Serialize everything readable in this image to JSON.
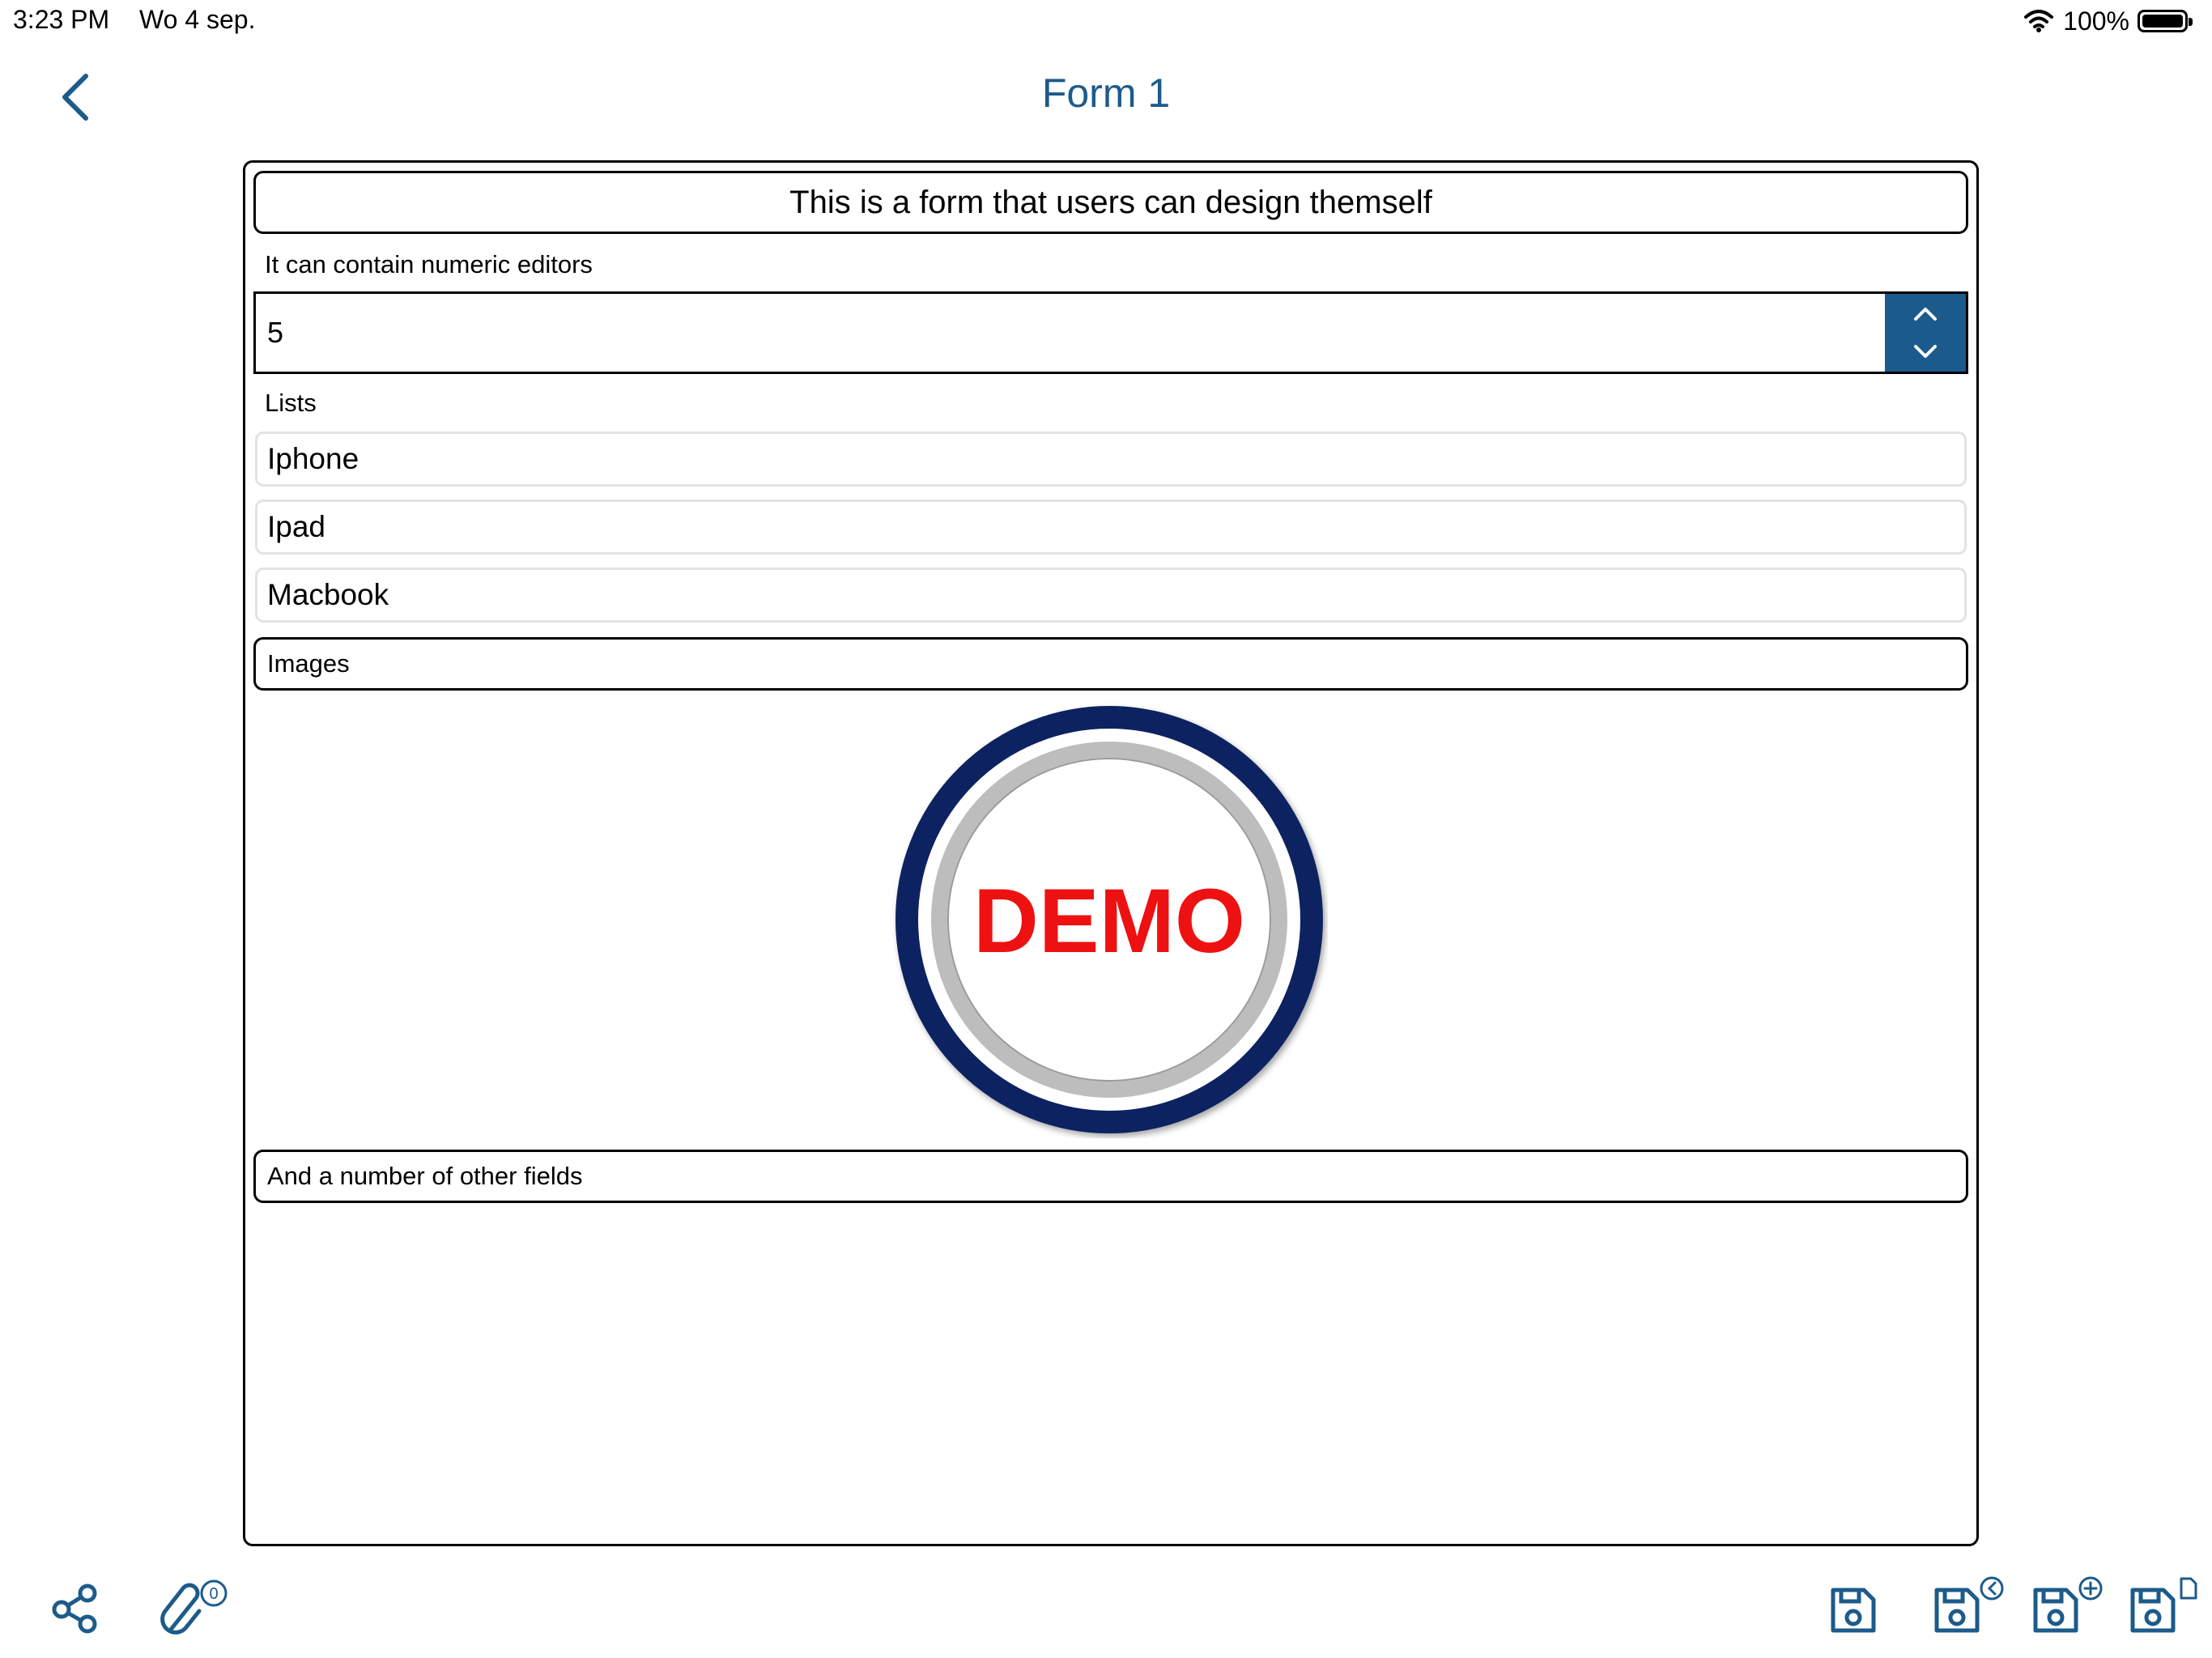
{
  "status_bar": {
    "time": "3:23 PM",
    "date": "Wo 4 sep.",
    "battery": "100%",
    "icons": [
      "wifi-icon",
      "battery-icon"
    ]
  },
  "nav": {
    "title": "Form 1",
    "back_icon": "chevron-left-icon"
  },
  "form": {
    "title": "This is a form that users can design themself",
    "numeric_label": "It can contain numeric editors",
    "numeric_value": "5",
    "lists_label": "Lists",
    "list_items": [
      "Iphone",
      "Ipad",
      "Macbook"
    ],
    "images_label": "Images",
    "image_text": "DEMO",
    "other_label": "And a number of other fields"
  },
  "toolbar": {
    "attachment_count": "0",
    "icons": [
      "share-icon",
      "attachment-icon",
      "save-icon",
      "save-back-icon",
      "save-new-icon",
      "save-as-document-icon"
    ]
  },
  "colors": {
    "accent": "#1c5b8a",
    "stepper": "#1a5a8c",
    "demo_ring": "#0a2360",
    "demo_text": "#ee1111"
  }
}
